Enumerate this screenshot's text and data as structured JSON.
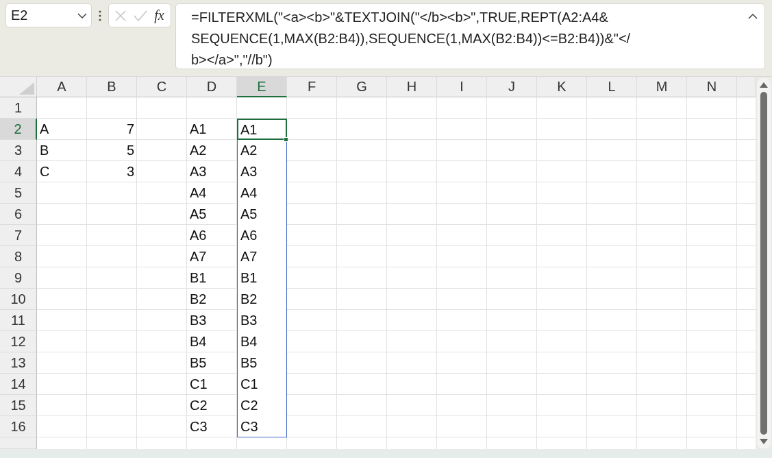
{
  "name_box": {
    "value": "E2"
  },
  "formula_buttons": {
    "function_label": "fx"
  },
  "formula_bar": {
    "lines": [
      "=FILTERXML(\"<a><b>\"&TEXTJOIN(\"</b><b>\",TRUE,REPT(A2:A4&",
      "SEQUENCE(1,MAX(B2:B4)),SEQUENCE(1,MAX(B2:B4))<=B2:B4))&\"</",
      "b></a>\",\"//b\")"
    ]
  },
  "columns": [
    {
      "label": "A",
      "selected": false
    },
    {
      "label": "B",
      "selected": false
    },
    {
      "label": "C",
      "selected": false
    },
    {
      "label": "D",
      "selected": false
    },
    {
      "label": "E",
      "selected": true
    },
    {
      "label": "F",
      "selected": false
    },
    {
      "label": "G",
      "selected": false
    },
    {
      "label": "H",
      "selected": false
    },
    {
      "label": "I",
      "selected": false
    },
    {
      "label": "J",
      "selected": false
    },
    {
      "label": "K",
      "selected": false
    },
    {
      "label": "L",
      "selected": false
    },
    {
      "label": "M",
      "selected": false
    },
    {
      "label": "N",
      "selected": false
    }
  ],
  "rows": [
    {
      "label": "1",
      "selected": false,
      "cells": [
        null,
        null,
        null,
        null,
        null
      ]
    },
    {
      "label": "2",
      "selected": true,
      "cells": [
        {
          "text": "A",
          "kind": "text"
        },
        {
          "text": "7",
          "kind": "number"
        },
        null,
        {
          "text": "A1",
          "kind": "text"
        },
        {
          "text": "A1",
          "kind": "text",
          "spill": true,
          "selected": true
        }
      ]
    },
    {
      "label": "3",
      "selected": false,
      "cells": [
        {
          "text": "B",
          "kind": "text"
        },
        {
          "text": "5",
          "kind": "number"
        },
        null,
        {
          "text": "A2",
          "kind": "text"
        },
        {
          "text": "A2",
          "kind": "text",
          "spill": true,
          "selected": false
        }
      ]
    },
    {
      "label": "4",
      "selected": false,
      "cells": [
        {
          "text": "C",
          "kind": "text"
        },
        {
          "text": "3",
          "kind": "number"
        },
        null,
        {
          "text": "A3",
          "kind": "text"
        },
        {
          "text": "A3",
          "kind": "text",
          "spill": true,
          "selected": false
        }
      ]
    },
    {
      "label": "5",
      "selected": false,
      "cells": [
        null,
        null,
        null,
        {
          "text": "A4",
          "kind": "text"
        },
        {
          "text": "A4",
          "kind": "text",
          "spill": true,
          "selected": false
        }
      ]
    },
    {
      "label": "6",
      "selected": false,
      "cells": [
        null,
        null,
        null,
        {
          "text": "A5",
          "kind": "text"
        },
        {
          "text": "A5",
          "kind": "text",
          "spill": true,
          "selected": false
        }
      ]
    },
    {
      "label": "7",
      "selected": false,
      "cells": [
        null,
        null,
        null,
        {
          "text": "A6",
          "kind": "text"
        },
        {
          "text": "A6",
          "kind": "text",
          "spill": true,
          "selected": false
        }
      ]
    },
    {
      "label": "8",
      "selected": false,
      "cells": [
        null,
        null,
        null,
        {
          "text": "A7",
          "kind": "text"
        },
        {
          "text": "A7",
          "kind": "text",
          "spill": true,
          "selected": false
        }
      ]
    },
    {
      "label": "9",
      "selected": false,
      "cells": [
        null,
        null,
        null,
        {
          "text": "B1",
          "kind": "text"
        },
        {
          "text": "B1",
          "kind": "text",
          "spill": true,
          "selected": false
        }
      ]
    },
    {
      "label": "10",
      "selected": false,
      "cells": [
        null,
        null,
        null,
        {
          "text": "B2",
          "kind": "text"
        },
        {
          "text": "B2",
          "kind": "text",
          "spill": true,
          "selected": false
        }
      ]
    },
    {
      "label": "11",
      "selected": false,
      "cells": [
        null,
        null,
        null,
        {
          "text": "B3",
          "kind": "text"
        },
        {
          "text": "B3",
          "kind": "text",
          "spill": true,
          "selected": false
        }
      ]
    },
    {
      "label": "12",
      "selected": false,
      "cells": [
        null,
        null,
        null,
        {
          "text": "B4",
          "kind": "text"
        },
        {
          "text": "B4",
          "kind": "text",
          "spill": true,
          "selected": false
        }
      ]
    },
    {
      "label": "13",
      "selected": false,
      "cells": [
        null,
        null,
        null,
        {
          "text": "B5",
          "kind": "text"
        },
        {
          "text": "B5",
          "kind": "text",
          "spill": true,
          "selected": false
        }
      ]
    },
    {
      "label": "14",
      "selected": false,
      "cells": [
        null,
        null,
        null,
        {
          "text": "C1",
          "kind": "text"
        },
        {
          "text": "C1",
          "kind": "text",
          "spill": true,
          "selected": false
        }
      ]
    },
    {
      "label": "15",
      "selected": false,
      "cells": [
        null,
        null,
        null,
        {
          "text": "C2",
          "kind": "text"
        },
        {
          "text": "C2",
          "kind": "text",
          "spill": true,
          "selected": false
        }
      ]
    },
    {
      "label": "16",
      "selected": false,
      "cells": [
        null,
        null,
        null,
        {
          "text": "C3",
          "kind": "text"
        },
        {
          "text": "C3",
          "kind": "text",
          "spill": true,
          "selected": false
        }
      ]
    }
  ]
}
